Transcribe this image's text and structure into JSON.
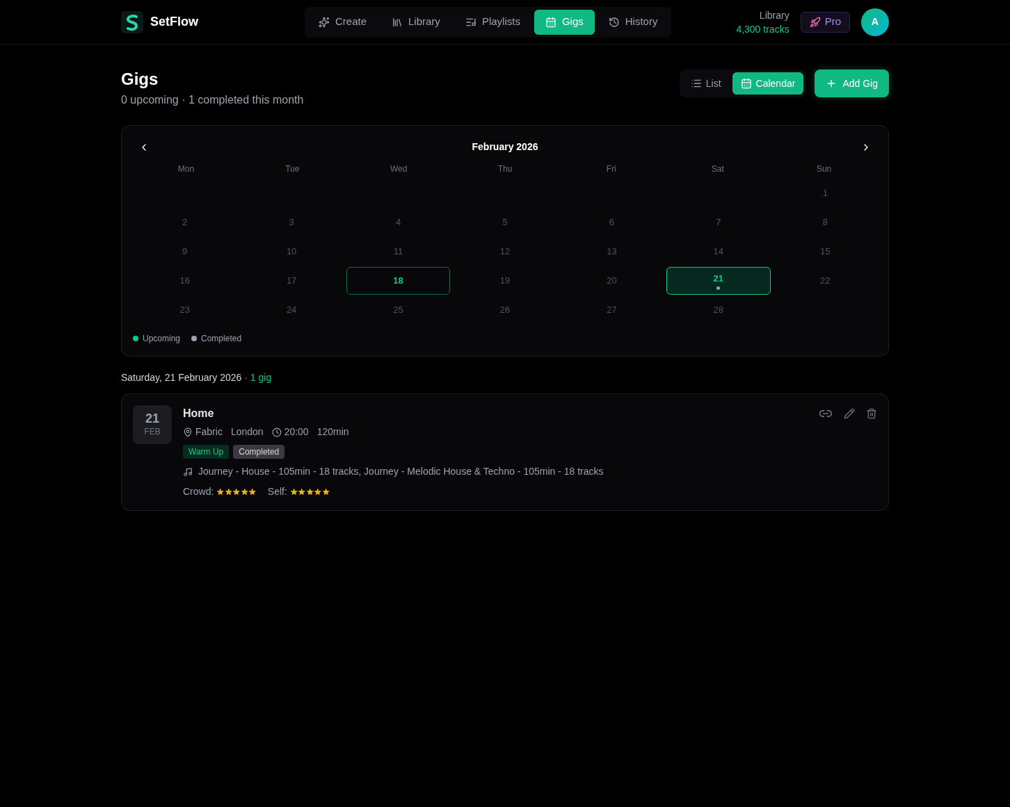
{
  "brand": {
    "name": "SetFlow"
  },
  "nav": [
    {
      "label": "Create",
      "selected": false
    },
    {
      "label": "Library",
      "selected": false
    },
    {
      "label": "Playlists",
      "selected": false
    },
    {
      "label": "Gigs",
      "selected": true
    },
    {
      "label": "History",
      "selected": false
    }
  ],
  "library": {
    "label": "Library",
    "count": "4,300 tracks"
  },
  "plan_badge": "Pro",
  "avatar": "A",
  "page": {
    "title": "Gigs",
    "upcoming": "0 upcoming",
    "separator": "·",
    "completed": "1 completed this month"
  },
  "views": [
    {
      "label": "List",
      "selected": false
    },
    {
      "label": "Calendar",
      "selected": true
    }
  ],
  "add_button": "Add Gig",
  "calendar": {
    "month": "February 2026",
    "weekdays": [
      "Mon",
      "Tue",
      "Wed",
      "Thu",
      "Fri",
      "Sat",
      "Sun"
    ],
    "weeks": [
      [
        {
          "label": "1",
          "today": false,
          "selected": false
        }
      ],
      [
        {
          "label": "2",
          "today": false,
          "selected": false
        },
        {
          "label": "3",
          "today": false,
          "selected": false
        },
        {
          "label": "4",
          "today": false,
          "selected": false
        },
        {
          "label": "5",
          "today": false,
          "selected": false
        },
        {
          "label": "6",
          "today": false,
          "selected": false
        },
        {
          "label": "7",
          "today": false,
          "selected": false
        },
        {
          "label": "8",
          "today": false,
          "selected": false
        }
      ],
      [
        {
          "label": "9",
          "today": false,
          "selected": false
        },
        {
          "label": "10",
          "today": false,
          "selected": false
        },
        {
          "label": "11",
          "today": false,
          "selected": false
        },
        {
          "label": "12",
          "today": false,
          "selected": false
        },
        {
          "label": "13",
          "today": false,
          "selected": false
        },
        {
          "label": "14",
          "today": false,
          "selected": false
        },
        {
          "label": "15",
          "today": false,
          "selected": false
        }
      ],
      [
        {
          "label": "16",
          "today": false,
          "selected": false
        },
        {
          "label": "17",
          "today": false,
          "selected": false
        },
        {
          "label": "18",
          "today": true,
          "selected": false
        },
        {
          "label": "19",
          "today": false,
          "selected": false
        },
        {
          "label": "20",
          "today": false,
          "selected": false
        },
        {
          "label": "21",
          "today": false,
          "selected": true,
          "color": "#9ca3af"
        },
        {
          "label": "22",
          "today": false,
          "selected": false
        }
      ],
      [
        {
          "label": "23",
          "today": false,
          "selected": false
        },
        {
          "label": "24",
          "today": false,
          "selected": false
        },
        {
          "label": "25",
          "today": false,
          "selected": false
        },
        {
          "label": "26",
          "today": false,
          "selected": false
        },
        {
          "label": "27",
          "today": false,
          "selected": false
        },
        {
          "label": "28",
          "today": false,
          "selected": false
        }
      ]
    ],
    "legend": [
      {
        "label": "Upcoming",
        "color": "#10c98a"
      },
      {
        "label": "Completed",
        "color": "#9ca3af"
      }
    ]
  },
  "selected_day": {
    "date": "Saturday, 21 February 2026",
    "separator": "·",
    "count": "1 gig"
  },
  "gigs": [
    {
      "day": "21",
      "month": "FEB",
      "title": "Home",
      "venue": "Fabric",
      "city": "London",
      "time": "20:00",
      "duration": "120min",
      "tags": [
        {
          "label": "Warm Up",
          "kind": "role"
        },
        {
          "label": "Completed",
          "kind": "status"
        }
      ],
      "playlists": "Journey - House - 105min - 18 tracks, Journey - Melodic House & Techno - 105min - 18 tracks",
      "ratings": [
        {
          "label": "Crowd:",
          "stars": 5
        },
        {
          "label": "Self:",
          "stars": 5
        }
      ]
    }
  ]
}
